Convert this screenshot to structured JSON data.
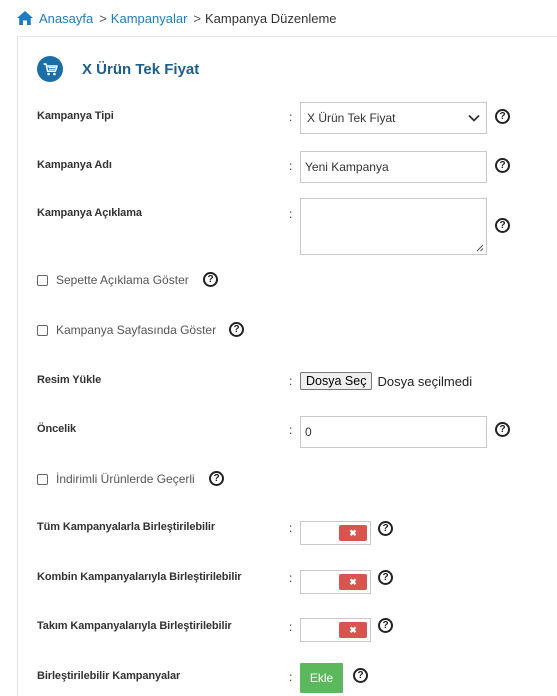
{
  "breadcrumb": {
    "home": "Anasayfa",
    "sep1": ">",
    "campaigns": "Kampanyalar",
    "sep2": ">",
    "current": "Kampanya Düzenleme"
  },
  "header": {
    "title": "X Ürün Tek Fiyat",
    "icon": "cart-icon"
  },
  "form": {
    "colon": ":",
    "help_glyph": "?",
    "campaign_type": {
      "label": "Kampanya Tipi",
      "value": "X Ürün Tek Fiyat"
    },
    "campaign_name": {
      "label": "Kampanya Adı",
      "value": "Yeni Kampanya"
    },
    "campaign_desc": {
      "label": "Kampanya Açıklama",
      "value": ""
    },
    "show_desc_cart": {
      "label": "Sepette Açıklama Göster",
      "checked": false
    },
    "show_on_page": {
      "label": "Kampanya Sayfasında Göster",
      "checked": false
    },
    "image_upload": {
      "label": "Resim Yükle",
      "button": "Dosya Seç",
      "status": "Dosya seçilmedi"
    },
    "priority": {
      "label": "Öncelik",
      "value": "0"
    },
    "discounted_valid": {
      "label": "İndirimli Ürünlerde Geçerli",
      "checked": false
    },
    "combine_all": {
      "label": "Tüm Kampanyalarla Birleştirilebilir",
      "state": "off",
      "off_glyph": "✖"
    },
    "combine_combo": {
      "label": "Kombin Kampanyalarıyla Birleştirilebilir",
      "state": "off",
      "off_glyph": "✖"
    },
    "combine_team": {
      "label": "Takım Kampanyalarıyla Birleştirilebilir",
      "state": "off",
      "off_glyph": "✖"
    },
    "combinable": {
      "label": "Birleştirilebilir Kampanyalar",
      "button": "Ekle"
    }
  },
  "colors": {
    "link": "#1e7dc2",
    "title": "#1c5f8e",
    "badge": "#1c6fa6",
    "toggle_off": "#d9534f",
    "add_button": "#5cb85c"
  }
}
